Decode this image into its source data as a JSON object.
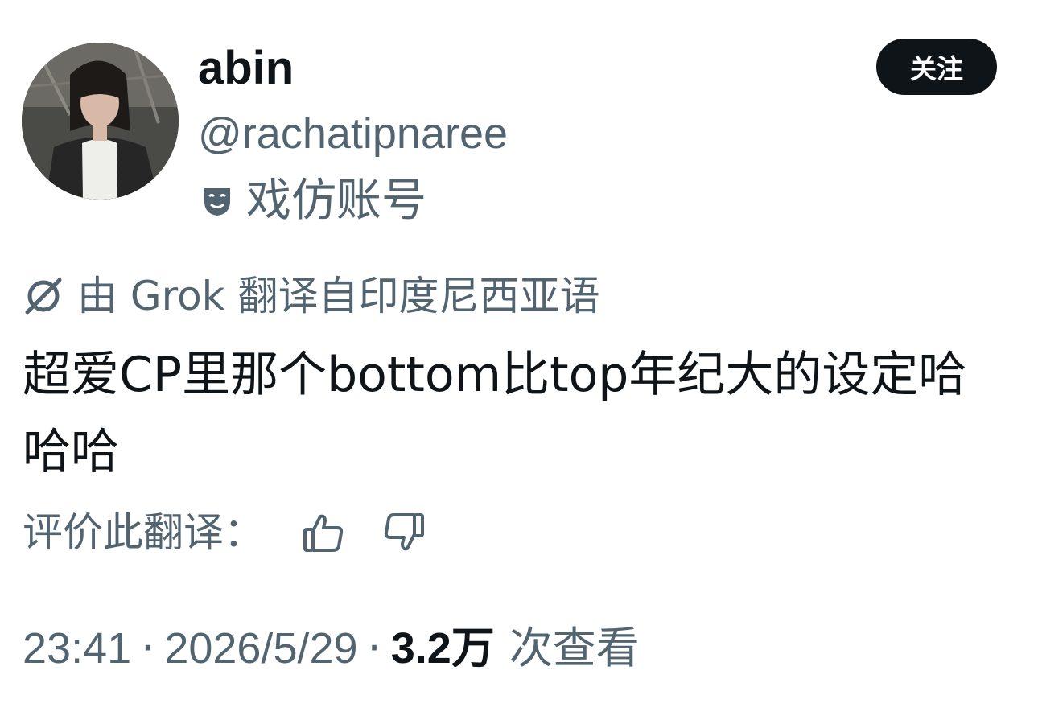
{
  "author": {
    "display_name": "abin",
    "handle": "@rachatipnaree",
    "avatar_icon": "profile-photo",
    "parody_label": "戏仿账号",
    "parody_icon": "theater-mask-icon"
  },
  "follow_button": {
    "label": "关注"
  },
  "translation": {
    "notice": "由 Grok 翻译自印度尼西亚语",
    "notice_icon": "grok-icon",
    "text": "超爱CP里那个bottom比top年纪大的设定哈哈哈"
  },
  "rating": {
    "label": "评价此翻译：",
    "up_icon": "thumbs-up-icon",
    "down_icon": "thumbs-down-icon"
  },
  "meta": {
    "time": "23:41",
    "separator": "·",
    "date": "2026/5/29",
    "views_count": "3.2万",
    "views_label": "次查看"
  },
  "colors": {
    "text_primary": "#0f1419",
    "text_secondary": "#536471",
    "button_bg": "#0f1419",
    "button_text": "#ffffff"
  }
}
